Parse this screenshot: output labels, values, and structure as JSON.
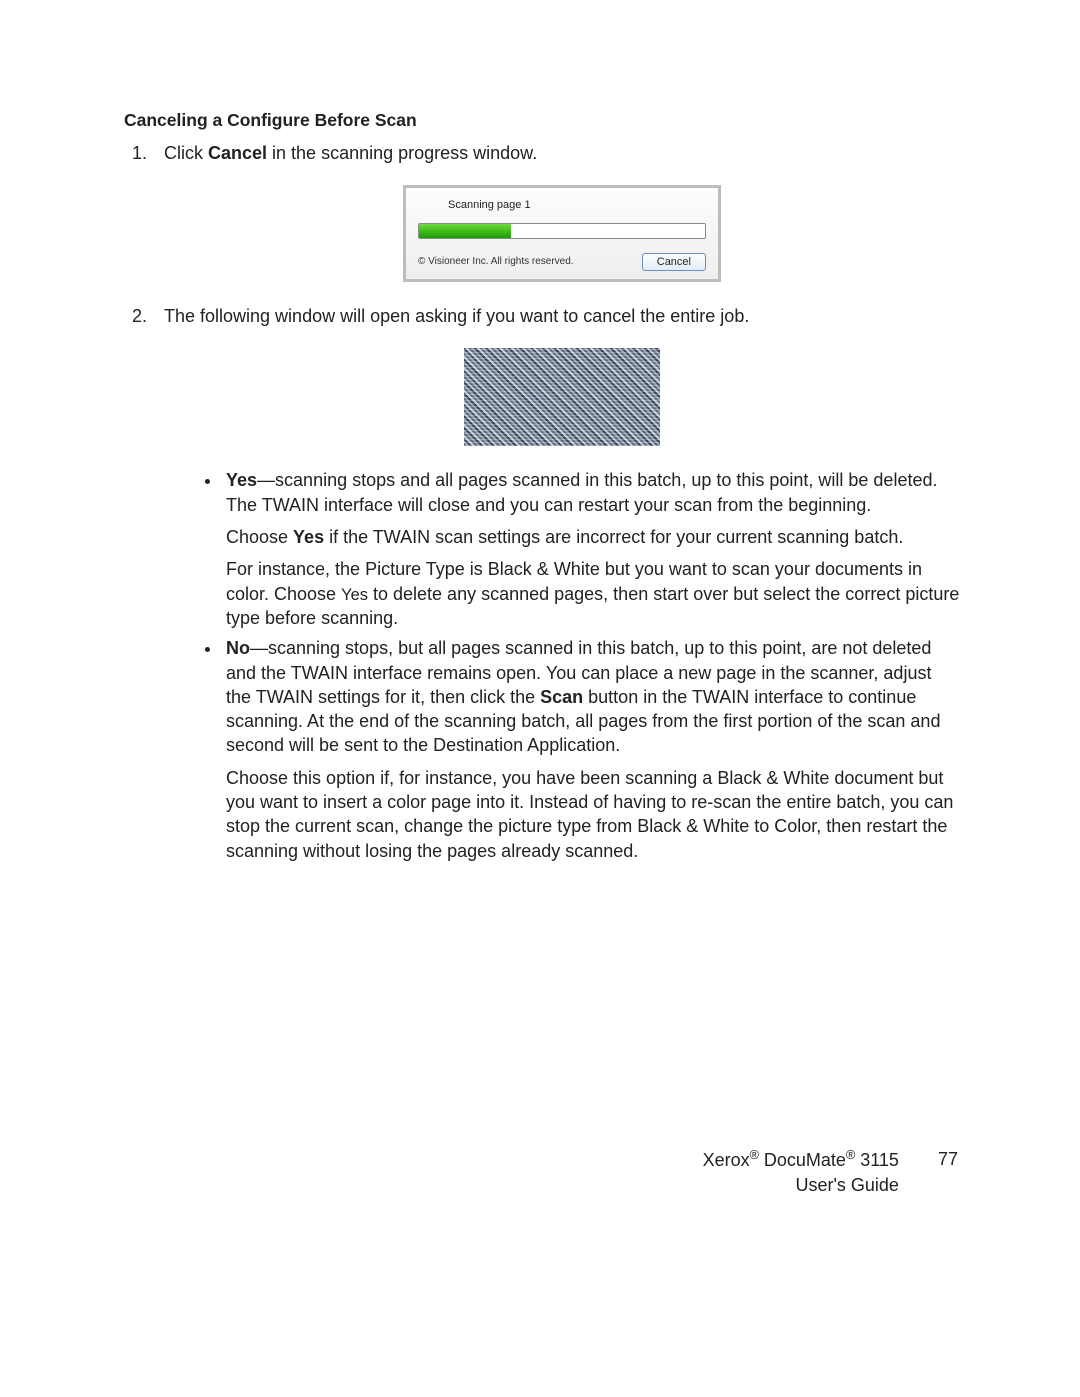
{
  "heading": "Canceling a Configure Before Scan",
  "steps": {
    "s1_pre": "Click ",
    "s1_bold": "Cancel",
    "s1_post": " in the scanning progress window.",
    "s2": "The following window will open asking if you want to cancel the entire job."
  },
  "dialog": {
    "status": "Scanning page 1",
    "copyright": "© Visioneer Inc. All rights reserved.",
    "cancel": "Cancel"
  },
  "yes": {
    "label": "Yes",
    "dash": "—",
    "p1": "scanning stops and all pages scanned in this batch, up to this point, will be deleted. The TWAIN interface will close and you can restart your scan from the beginning.",
    "p2a": "Choose ",
    "p2b": "Yes",
    "p2c": " if the TWAIN scan settings are incorrect for your current scanning batch.",
    "p3a": "For instance, the Picture Type is Black & White but you want to scan your documents in color. Choose ",
    "p3b": "Yes",
    "p3c": " to delete any scanned pages, then start over but select the correct picture type before scanning."
  },
  "no": {
    "label": "No",
    "dash": "—",
    "p1a": "scanning stops, but all pages scanned in this batch, up to this point, are not deleted and the TWAIN interface remains open. You can place a new page in the scanner, adjust the TWAIN settings for it, then click the ",
    "p1b": "Scan",
    "p1c": " button in the TWAIN interface to continue scanning. At the end of the scanning batch, all pages from the first portion of the scan and second will be sent to the Destination Application.",
    "p2": "Choose this option if, for instance, you have been scanning a Black & White document but you want to insert a color page into it. Instead of having to re-scan the entire batch, you can stop the current scan, change the picture type from Black & White to Color, then restart the scanning without losing the pages already scanned."
  },
  "footer": {
    "product_a": "Xerox",
    "product_b": " DocuMate",
    "product_c": " 3115",
    "guide": "User's Guide",
    "page": "77"
  }
}
